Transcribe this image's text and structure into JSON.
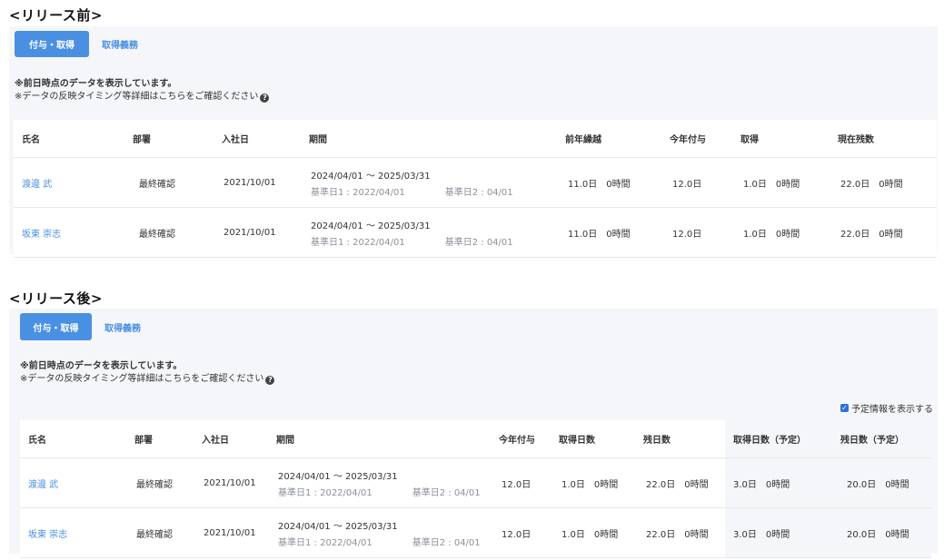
{
  "before": {
    "title": "<リリース前>",
    "tabs": {
      "active": "付与・取得",
      "link": "取得義務"
    },
    "notice": {
      "line1": "※前日時点のデータを表示しています。",
      "line2": "※データの反映タイミング等詳細はこちらをご確認ください"
    },
    "headers": [
      "氏名",
      "部署",
      "入社日",
      "期間",
      "前年繰越",
      "今年付与",
      "取得",
      "現在残数"
    ],
    "rows": [
      {
        "name": "渡邊 武",
        "dept": "最終確認",
        "joined": "2021/10/01",
        "period": "2024/04/01 〜 2025/03/31",
        "base1": "基準日1 : 2022/04/01",
        "base2": "基準日2 : 04/01",
        "carryover": "11.0日　0時間",
        "granted": "12.0日",
        "taken": "1.0日　0時間",
        "remaining": "22.0日　0時間"
      },
      {
        "name": "坂東 崇志",
        "dept": "最終確認",
        "joined": "2021/10/01",
        "period": "2024/04/01 〜 2025/03/31",
        "base1": "基準日1 : 2022/04/01",
        "base2": "基準日2 : 04/01",
        "carryover": "11.0日　0時間",
        "granted": "12.0日",
        "taken": "1.0日　0時間",
        "remaining": "22.0日　0時間"
      }
    ]
  },
  "after": {
    "title": "<リリース後>",
    "tabs": {
      "active": "付与・取得",
      "link": "取得義務"
    },
    "notice": {
      "line1": "※前日時点のデータを表示しています。",
      "line2": "※データの反映タイミング等詳細はこちらをご確認ください"
    },
    "checkbox_label": "予定情報を表示する",
    "headers": [
      "氏名",
      "部署",
      "入社日",
      "期間",
      "今年付与",
      "取得日数",
      "残日数",
      "取得日数（予定）",
      "残日数（予定）"
    ],
    "rows": [
      {
        "name": "渡邊 武",
        "dept": "最終確認",
        "joined": "2021/10/01",
        "period": "2024/04/01 〜 2025/03/31",
        "base1": "基準日1 : 2022/04/01",
        "base2": "基準日2 : 04/01",
        "granted": "12.0日",
        "taken": "1.0日　0時間",
        "remaining": "22.0日　0時間",
        "taken_planned": "3.0日　0時間",
        "remaining_planned": "20.0日　0時間"
      },
      {
        "name": "坂東 崇志",
        "dept": "最終確認",
        "joined": "2021/10/01",
        "period": "2024/04/01 〜 2025/03/31",
        "base1": "基準日1 : 2022/04/01",
        "base2": "基準日2 : 04/01",
        "granted": "12.0日",
        "taken": "1.0日　0時間",
        "remaining": "22.0日　0時間",
        "taken_planned": "3.0日　0時間",
        "remaining_planned": "20.0日　0時間"
      }
    ]
  },
  "colors": {
    "accent": "#4a90e2",
    "panel": "#f5f6f9",
    "subtext": "#8a8f99"
  },
  "icons": {
    "help": "question-circle-icon",
    "check": "checkbox-checked-icon"
  }
}
